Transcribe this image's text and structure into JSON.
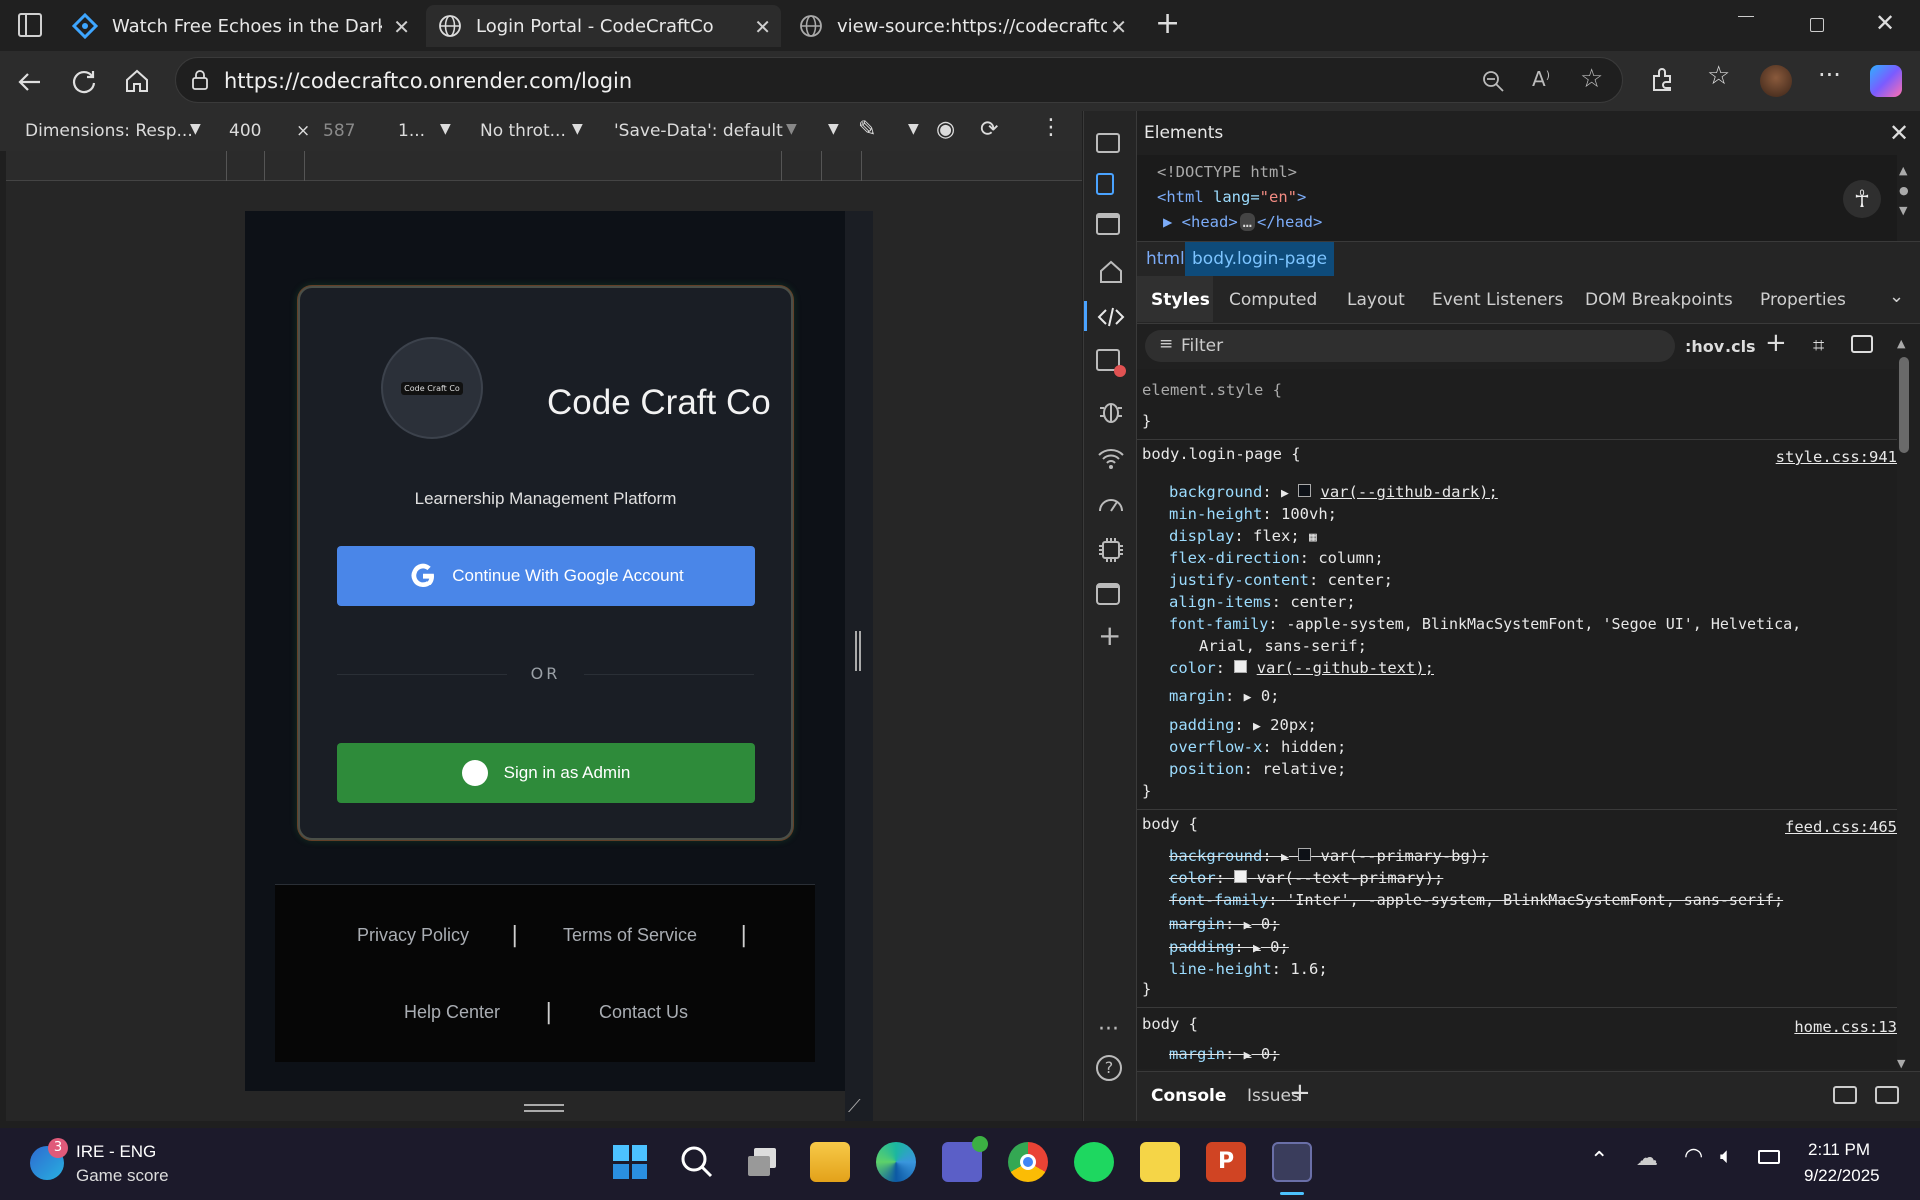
{
  "browser": {
    "tabs": [
      {
        "title": "Watch Free Echoes in the Dark Fu",
        "active": false
      },
      {
        "title": "Login Portal - CodeCraftCo",
        "active": true
      },
      {
        "title": "view-source:https://codecraftco.o",
        "active": false
      }
    ],
    "url": "https://codecraftco.onrender.com/login"
  },
  "device_toolbar": {
    "dimensions": "Dimensions: Resp...",
    "width": "400",
    "times": "×",
    "height": "587",
    "zoom": "1...",
    "throttle": "No throt...",
    "save_data": "'Save-Data': default"
  },
  "login_page": {
    "logo_text": "Code Craft Co",
    "brand": "Code Craft Co",
    "subtitle": "Learnership Management Platform",
    "google_button": "Continue With Google Account",
    "or": "OR",
    "admin_button": "Sign in as Admin",
    "footer": {
      "privacy": "Privacy Policy",
      "terms": "Terms of Service",
      "help": "Help Center",
      "contact": "Contact Us",
      "sep": "|"
    }
  },
  "devtools": {
    "panel_title": "Elements",
    "dom": {
      "doctype": "<!DOCTYPE html>",
      "html_open_tag": "<html",
      "html_attr_name": " lang=",
      "html_attr_val": "\"en\"",
      "html_close": ">",
      "head_open": "<head>",
      "head_ellipsis": "…",
      "head_close": "</head>"
    },
    "breadcrumbs": [
      "html",
      "body.login-page"
    ],
    "style_tabs": [
      "Styles",
      "Computed",
      "Layout",
      "Event Listeners",
      "DOM Breakpoints",
      "Properties"
    ],
    "filter_placeholder": "Filter",
    "hov": ":hov",
    "cls": ".cls",
    "rules": {
      "element_style": "element.style {",
      "close": "}",
      "r1_selector": "body.login-page {",
      "r1_file": "style.css:941",
      "r1_props": [
        {
          "name": "background",
          "value": "var(--github-dark);"
        },
        {
          "name": "min-height",
          "value": "100vh;"
        },
        {
          "name": "display",
          "value": "flex;"
        },
        {
          "name": "flex-direction",
          "value": "column;"
        },
        {
          "name": "justify-content",
          "value": "center;"
        },
        {
          "name": "align-items",
          "value": "center;"
        },
        {
          "name": "font-family",
          "value": "-apple-system, BlinkMacSystemFont, 'Segoe UI', Helvetica,"
        },
        {
          "name": "",
          "value": "Arial, sans-serif;"
        },
        {
          "name": "color",
          "value": "var(--github-text);"
        },
        {
          "name": "margin",
          "value": "0;"
        },
        {
          "name": "padding",
          "value": "20px;"
        },
        {
          "name": "overflow-x",
          "value": "hidden;"
        },
        {
          "name": "position",
          "value": "relative;"
        }
      ],
      "r2_selector": "body {",
      "r2_file": "feed.css:465",
      "r2_props": [
        {
          "name": "background",
          "value": "var(--primary-bg);"
        },
        {
          "name": "color",
          "value": "var(--text-primary);"
        },
        {
          "name": "font-family",
          "value": "'Inter', -apple-system, BlinkMacSystemFont, sans-serif;"
        },
        {
          "name": "margin",
          "value": "0;"
        },
        {
          "name": "padding",
          "value": "0;"
        },
        {
          "name": "line-height",
          "value": "1.6;"
        }
      ],
      "r3_selector": "body {",
      "r3_file": "home.css:13",
      "r3_props": [
        {
          "name": "margin",
          "value": "0;"
        }
      ]
    },
    "bottom_tabs": [
      "Console",
      "Issues"
    ]
  },
  "taskbar": {
    "weather_badge": "3",
    "weather_title": "IRE - ENG",
    "weather_sub": "Game score",
    "time": "2:11 PM",
    "date": "9/22/2025"
  },
  "colors": {
    "google_blue": "#4a86e8",
    "admin_green": "#2e8b3a",
    "devtools_selected": "#0e4b7a"
  }
}
